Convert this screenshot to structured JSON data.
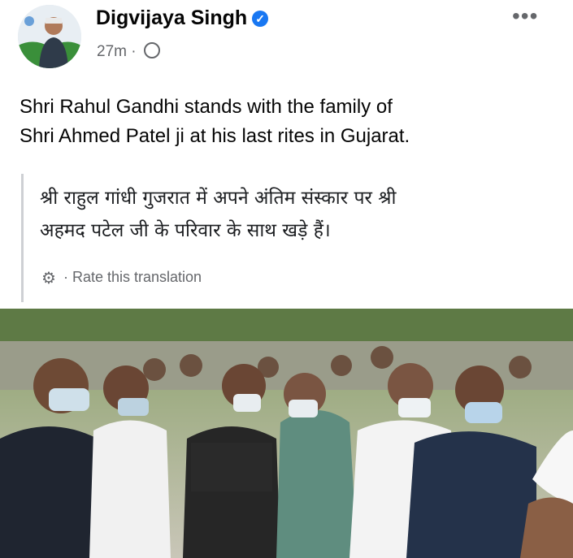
{
  "post": {
    "author": "Digvijaya Singh",
    "timestamp": "27m",
    "meta_sep": "·",
    "more_label": "•••",
    "verified_icon": "check-icon",
    "text_line1": "Shri Rahul Gandhi  stands with the family of",
    "text_line2": "Shri Ahmed Patel ji at his last rites in Gujarat."
  },
  "translation": {
    "line1": "श्री राहुल गांधी गुजरात में अपने अंतिम संस्कार पर श्री",
    "line2": "अहमद पटेल जी के परिवार के साथ खड़े हैं।",
    "rate_label": "Rate this translation",
    "rate_sep": "·"
  },
  "colors": {
    "accent": "#1877f2",
    "meta": "#65676b",
    "text": "#050505"
  }
}
